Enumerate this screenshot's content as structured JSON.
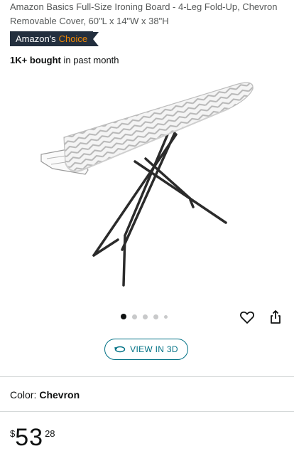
{
  "product": {
    "title": "Amazon Basics Full-Size Ironing Board - 4-Leg Fold-Up, Chevron Removable Cover, 60\"L x 14\"W x 38\"H",
    "badge": {
      "prefix": "Amazon's",
      "accent": "Choice"
    },
    "bought": {
      "count": "1K+ bought",
      "suffix": " in past month"
    },
    "image_icon": "ironing-board",
    "carousel": {
      "total_dots": 5,
      "active_index": 0
    },
    "view3d_label": "VIEW IN 3D",
    "color": {
      "label": "Color:",
      "value": "Chevron"
    },
    "price": {
      "symbol": "$",
      "whole": "53",
      "fraction": "28"
    }
  },
  "colors": {
    "badge_bg": "#232f3e",
    "badge_accent": "#f08804",
    "link_teal": "#007185",
    "text": "#0f1111"
  }
}
